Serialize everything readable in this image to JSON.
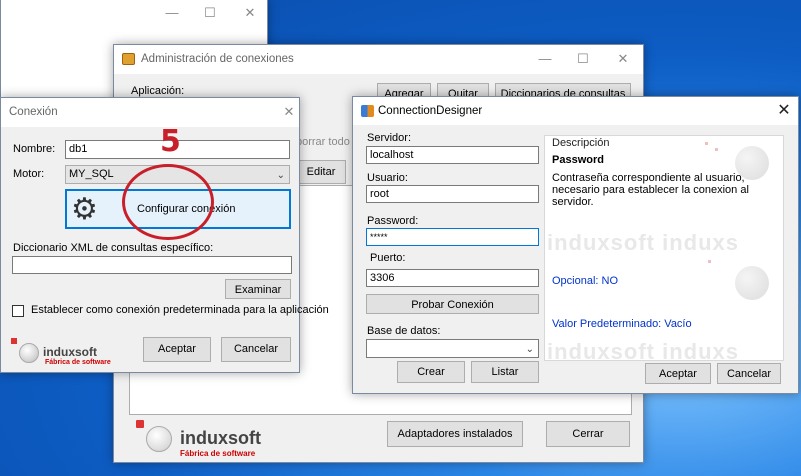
{
  "adm": {
    "title": "Administración de conexiones",
    "aplicacion_label": "Aplicación:",
    "agregar": "Agregar",
    "quitar": "Quitar",
    "diccionarios": "Diccionarios de consultas",
    "borrar_todo": "borrar todo",
    "editar": "Editar",
    "adaptadores": "Adaptadores instalados",
    "cerrar": "Cerrar"
  },
  "conexion": {
    "title": "Conexión",
    "nombre_label": "Nombre:",
    "nombre_value": "db1",
    "motor_label": "Motor:",
    "motor_value": "MY_SQL",
    "configurar": "Configurar conexión",
    "dicc_label": "Diccionario XML de consultas específico:",
    "dicc_value": "",
    "examinar": "Examinar",
    "predeterminada": "Establecer como conexión predeterminada para la aplicación",
    "aceptar": "Aceptar",
    "cancelar": "Cancelar"
  },
  "step": "5",
  "designer": {
    "title": "ConnectionDesigner",
    "servidor_label": "Servidor:",
    "servidor_value": "localhost",
    "usuario_label": "Usuario:",
    "usuario_value": "root",
    "password_label": "Password:",
    "password_value": "*****",
    "puerto_label": "Puerto:",
    "puerto_value": "3306",
    "probar": "Probar Conexión",
    "base_label": "Base de datos:",
    "base_value": "",
    "crear": "Crear",
    "listar": "Listar",
    "aceptar": "Aceptar",
    "cancelar": "Cancelar",
    "desc_header": "Descripción",
    "desc_title": "Password",
    "desc_text": "Contraseña correspondiente al usuario, necesario para establecer la conexion al servidor.",
    "opcional": "Opcional: NO",
    "valor_pred": "Valor Predeterminado: Vacío"
  },
  "logo": {
    "word": "induxsoft",
    "sub": "Fábrica de software",
    "watermark": "induxsoft induxs"
  },
  "colors": {
    "accent": "#0078d7",
    "link_blue": "#0033cc",
    "marker_red": "#c8202a"
  }
}
